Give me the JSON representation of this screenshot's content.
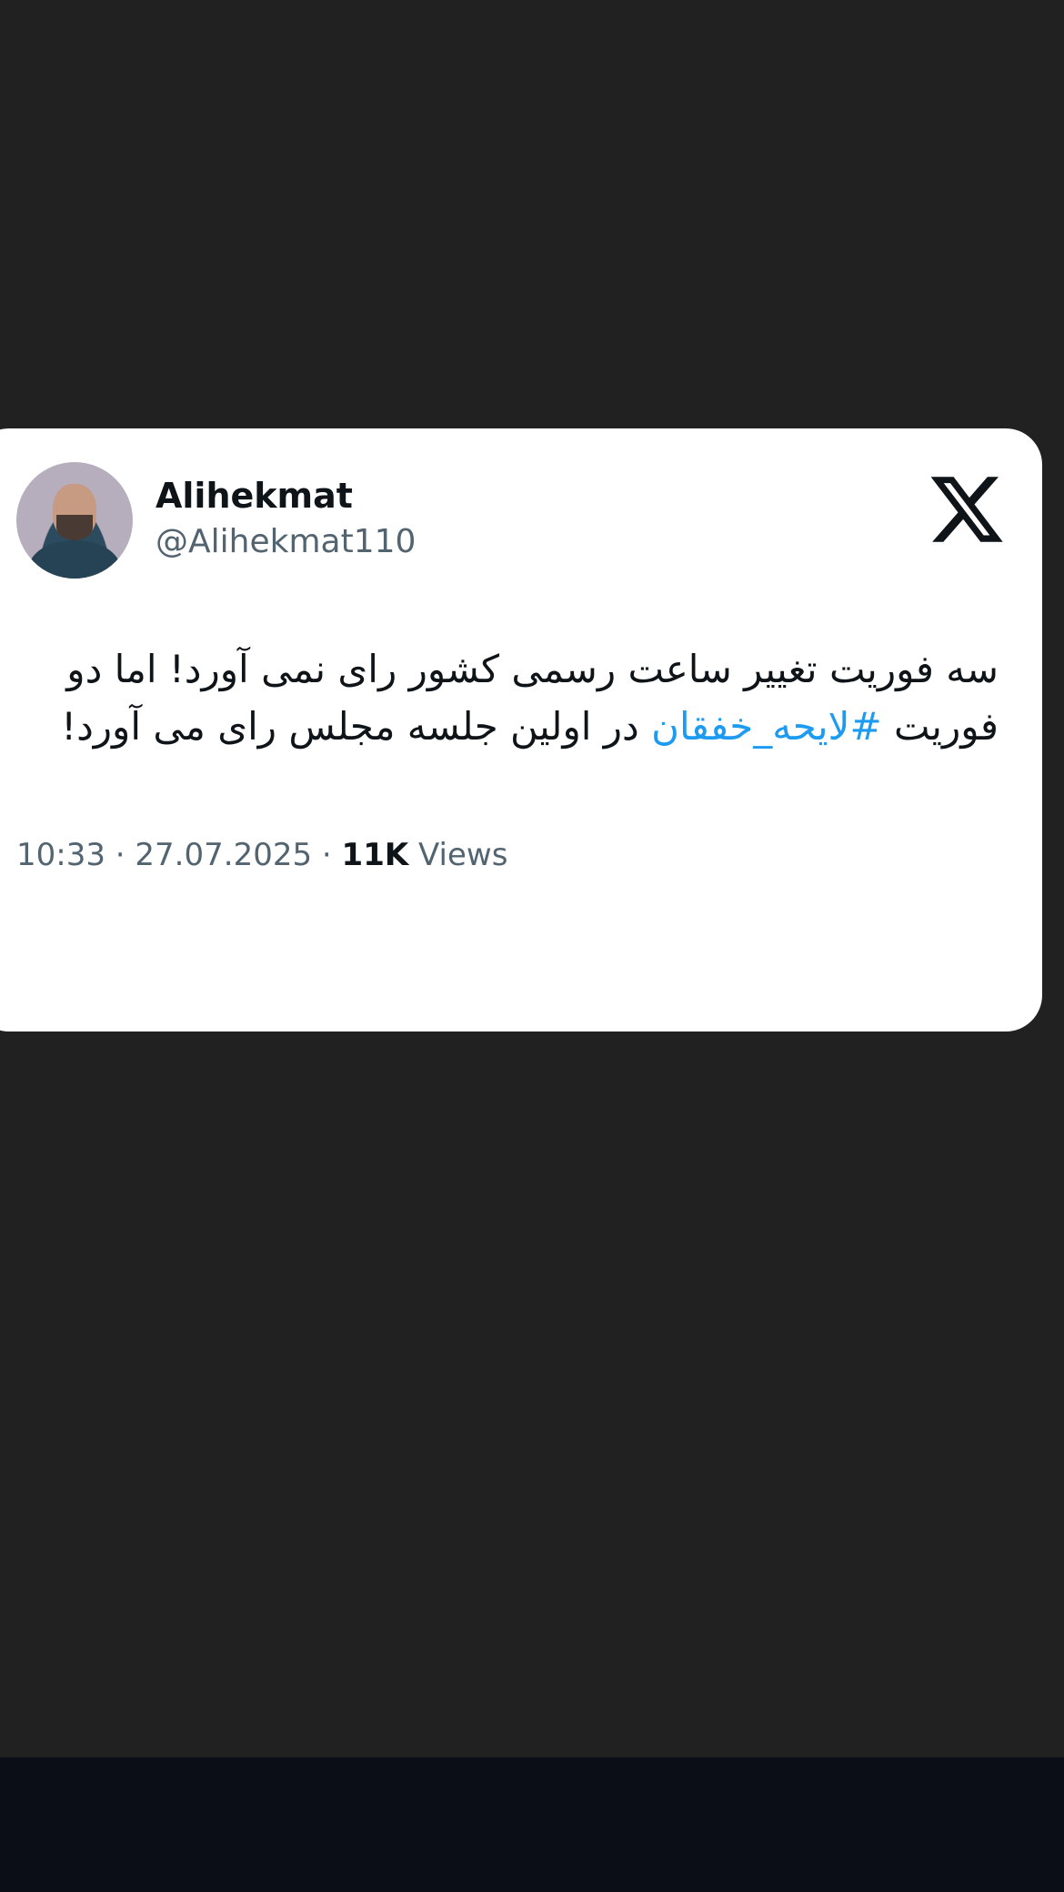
{
  "tweet": {
    "display_name": "Alihekmat",
    "handle": "@Alihekmat110",
    "text_part1": "سه فوریت تغییر ساعت رسمی کشور رای نمی آورد! اما دو فوریت ",
    "hashtag": "#لایحه_خفقان",
    "text_part2": " در اولین جلسه مجلس رای می آورد!",
    "time": "10:33",
    "date": "27.07.2025",
    "separator": "·",
    "views_count": "11K",
    "views_label": "Views",
    "hashtag_color": "#1d9bf0"
  },
  "icons": {
    "logo": "x-logo-icon",
    "avatar": "profile-avatar"
  },
  "colors": {
    "background": "#212121",
    "card": "#ffffff",
    "bottom_bar": "#0b0e16"
  }
}
